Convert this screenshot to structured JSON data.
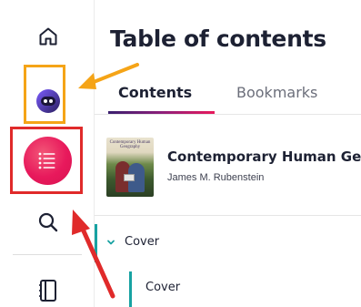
{
  "main": {
    "title": "Table of contents",
    "tabs": [
      {
        "label": "Contents",
        "active": true
      },
      {
        "label": "Bookmarks",
        "active": false
      }
    ]
  },
  "book": {
    "title": "Contemporary Human Geography",
    "author": "James M. Rubenstein",
    "cover_title": "Contemporary Human Geography"
  },
  "toc": {
    "section_label": "Cover",
    "subitem_label": "Cover"
  },
  "sidebar": {
    "items": [
      {
        "icon": "home-icon"
      },
      {
        "icon": "ai-assistant-icon"
      },
      {
        "icon": "table-of-contents-icon",
        "active": true
      },
      {
        "icon": "search-icon"
      },
      {
        "icon": "notebook-icon"
      }
    ]
  },
  "colors": {
    "accent_pink": "#e8195c",
    "accent_teal": "#17a2a2",
    "annotation_orange": "#f5a417",
    "annotation_red": "#e02a2a",
    "text_dark": "#1d2133"
  }
}
